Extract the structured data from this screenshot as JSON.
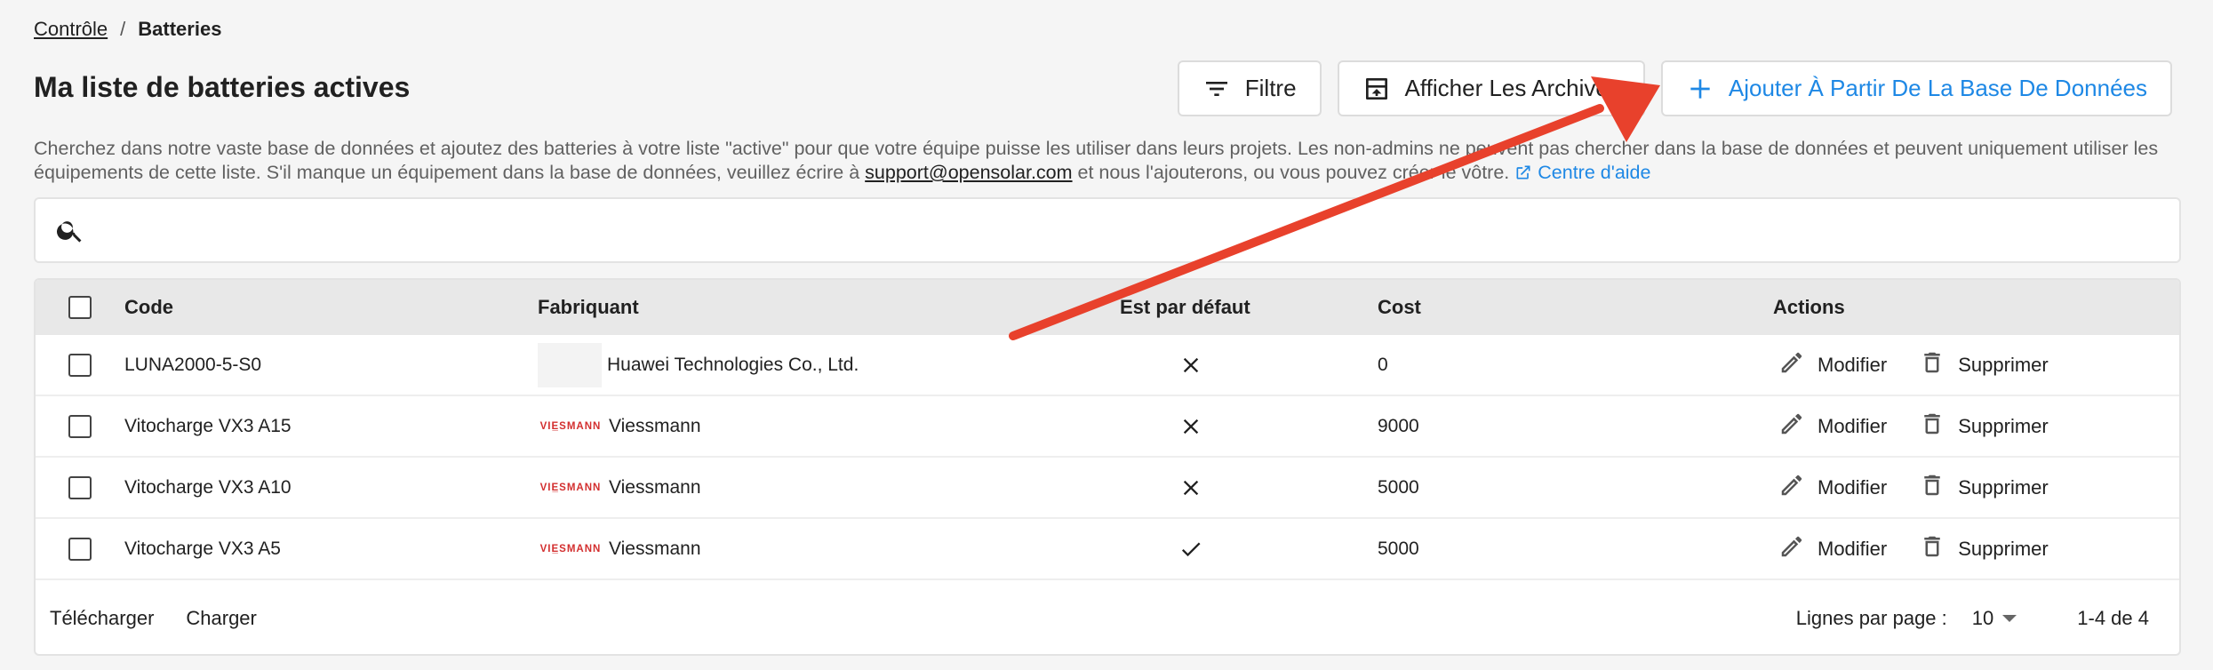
{
  "breadcrumb": {
    "parent": "Contrôle",
    "separator": "/",
    "current": "Batteries"
  },
  "page": {
    "title": "Ma liste de batteries actives"
  },
  "toolbar": {
    "filter_label": "Filtre",
    "archives_label": "Afficher Les Archives",
    "add_label": "Ajouter À Partir De La Base De Données"
  },
  "description": {
    "text1": "Cherchez dans notre vaste base de données et ajoutez des batteries à votre liste \"active\" pour que votre équipe puisse les utiliser dans leurs projets. Les non-admins ne peuvent pas chercher dans la base de données et peuvent uniquement utiliser les équipements de cette liste. S'il manque un équipement dans la base de données, veuillez écrire à ",
    "email": "support@opensolar.com",
    "text2": " et nous l'ajouterons, ou vous pouvez créer le vôtre. ",
    "help_link": "Centre d'aide"
  },
  "search": {
    "placeholder": ""
  },
  "table": {
    "headers": {
      "code": "Code",
      "manufacturer": "Fabriquant",
      "default": "Est par défaut",
      "cost": "Cost",
      "actions": "Actions"
    },
    "rows": [
      {
        "code": "LUNA2000-5-S0",
        "manufacturer": "Huawei Technologies Co., Ltd.",
        "logo": "blank",
        "is_default": false,
        "cost": "0"
      },
      {
        "code": "Vitocharge VX3 A15",
        "manufacturer": "Viessmann",
        "logo": "viessmann",
        "logo_text": "VIE̲SMANN",
        "is_default": false,
        "cost": "9000"
      },
      {
        "code": "Vitocharge VX3 A10",
        "manufacturer": "Viessmann",
        "logo": "viessmann",
        "logo_text": "VIE̲SMANN",
        "is_default": false,
        "cost": "5000"
      },
      {
        "code": "Vitocharge VX3 A5",
        "manufacturer": "Viessmann",
        "logo": "viessmann",
        "logo_text": "VIE̲SMANN",
        "is_default": true,
        "cost": "5000"
      }
    ],
    "edit_label": "Modifier",
    "delete_label": "Supprimer"
  },
  "footer": {
    "download_label": "Télécharger",
    "upload_label": "Charger",
    "rows_per_page_label": "Lignes par page :",
    "rows_per_page_value": "10",
    "range": "1-4 de 4"
  },
  "colors": {
    "accent": "#1e88e5",
    "annotation_arrow": "#e8412c"
  },
  "icons": {
    "filter": "filter-icon",
    "archive": "archive-icon",
    "add": "plus-icon",
    "search": "search-icon",
    "external": "external-link-icon",
    "edit": "pencil-icon",
    "delete": "trash-icon",
    "default_true": "check-icon",
    "default_false": "close-icon"
  }
}
